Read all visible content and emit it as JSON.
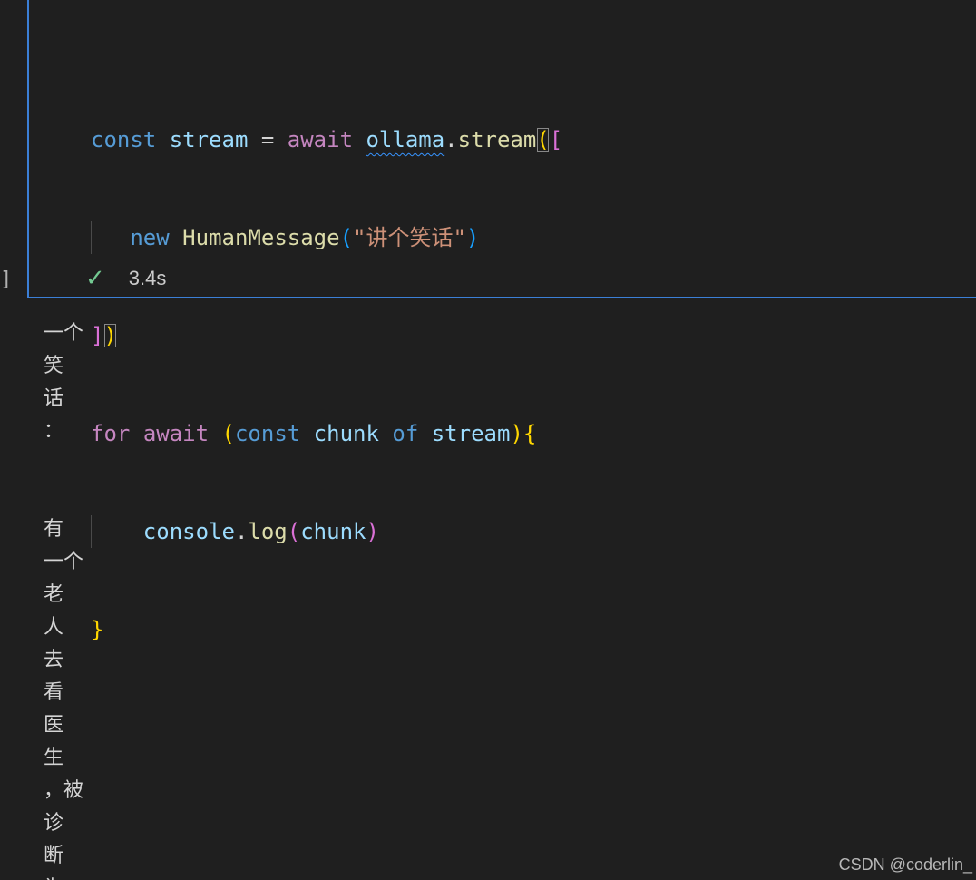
{
  "cell": {
    "exec_bracket": "]",
    "status_check": "✓",
    "duration": "3.4s",
    "code": {
      "l1": {
        "kw_const": "const",
        "var_stream": "stream",
        "eq": "=",
        "kw_await": "await",
        "obj": "ollama",
        "dot": ".",
        "method": "stream",
        "paren_open": "(",
        "bracket_open": "["
      },
      "l2": {
        "kw_new": "new",
        "cls": "HumanMessage",
        "paren_open": "(",
        "str": "\"讲个笑话\"",
        "paren_close": ")"
      },
      "l3": {
        "bracket_close": "]",
        "paren_close": ")"
      },
      "l4": {
        "kw_for": "for",
        "kw_await": "await",
        "paren_open": "(",
        "kw_const": "const",
        "var_chunk": "chunk",
        "kw_of": "of",
        "var_stream": "stream",
        "paren_close": ")",
        "brace_open": "{"
      },
      "l5": {
        "obj": "console",
        "dot": ".",
        "method": "log",
        "paren_open": "(",
        "arg": "chunk",
        "paren_close": ")"
      },
      "l6": {
        "brace_close": "}"
      }
    }
  },
  "output": {
    "lines": [
      "一个",
      "笑",
      "话",
      "：",
      "",
      "",
      "有",
      "一个",
      "老",
      "人",
      "去",
      "看",
      "医",
      "生",
      "，被",
      "诊",
      "断",
      "为"
    ]
  },
  "watermark": "CSDN @coderlin_",
  "colors": {
    "background": "#1f1f1f",
    "cell_border": "#3b7fd6",
    "success_check": "#73c991"
  }
}
